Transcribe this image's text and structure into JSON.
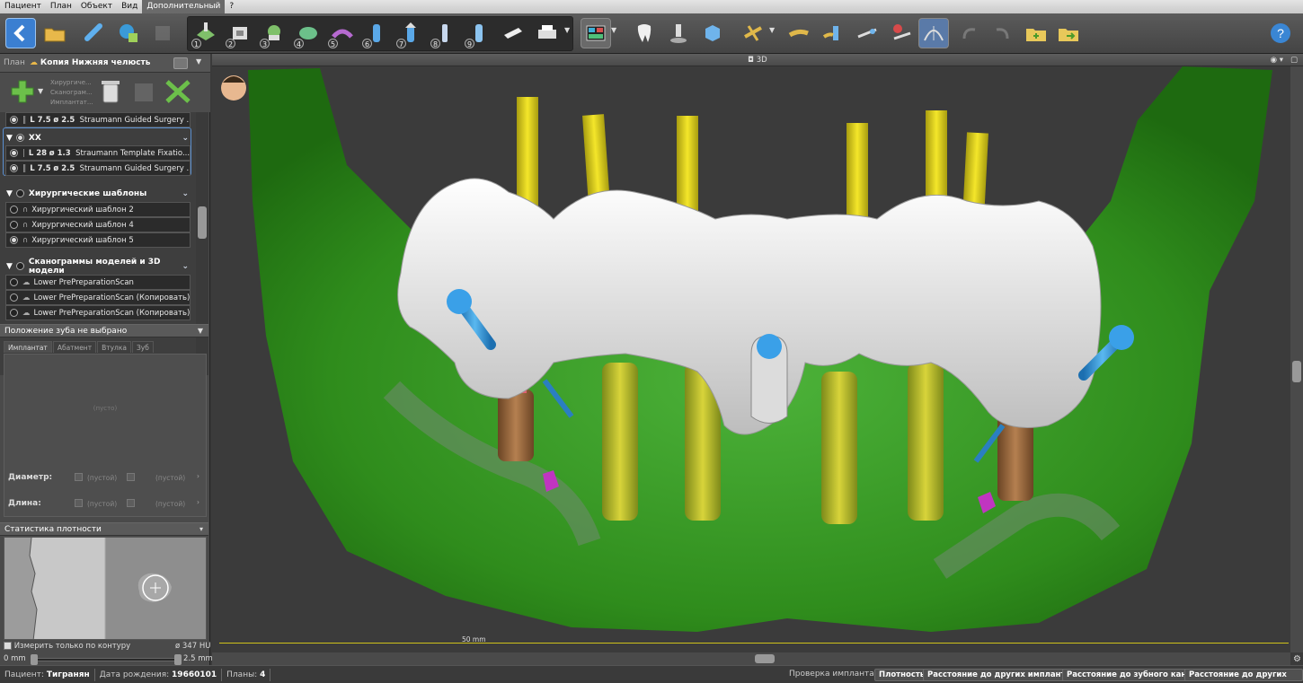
{
  "menu": [
    "Пациент",
    "План",
    "Объект",
    "Вид",
    "Дополнительный",
    "?"
  ],
  "menu_active": "Дополнительный",
  "toolbar": {
    "step_numbers": [
      "1",
      "2",
      "3",
      "4",
      "5",
      "6",
      "7",
      "8",
      "9"
    ]
  },
  "plan_panel": {
    "label": "План",
    "title": "Копия Нижняя челюсть",
    "side_labels": [
      "Хирургиче...",
      "Сканограм...",
      "Имплантат..."
    ]
  },
  "tree": {
    "top_row": {
      "L": "L 7.5",
      "d": "ø 2.5",
      "name": "Straumann Guided Surgery ..."
    },
    "group_xx": "XX",
    "xx_rows": [
      {
        "L": "L 28",
        "d": "ø 1.3",
        "name": "Straumann Template Fixatio..."
      },
      {
        "L": "L 7.5",
        "d": "ø 2.5",
        "name": "Straumann Guided Surgery ..."
      }
    ],
    "group_templates": "Хирургические шаблоны",
    "templates": [
      "Хирургический шаблон 2",
      "Хирургический шаблон 4",
      "Хирургический шаблон 5"
    ],
    "group_scans": "Сканограммы моделей и 3D модели",
    "scans": [
      "Lower PrePreparationScan",
      "Lower PrePreparationScan (Копировать)",
      "Lower PrePreparationScan (Копировать) (К..."
    ]
  },
  "tooth_section": {
    "title": "Положение зуба не выбрано",
    "tabs": [
      "Имплантат",
      "Абатмент",
      "Втулка",
      "Зуб"
    ],
    "empty": "(пусто)",
    "diameter_label": "Диаметр:",
    "length_label": "Длина:",
    "empty_value": "(пустой)"
  },
  "density": {
    "title": "Статистика плотности",
    "contour_label": "Измерить только по контуру",
    "hu": "ø 347 HU",
    "min": "0 mm",
    "max": "2.5 mm"
  },
  "viewport": {
    "title": "3D",
    "scale_label": "50 mm"
  },
  "status": {
    "patient_label": "Пациент:",
    "patient": "Тигранян",
    "dob_label": "Дата рождения:",
    "dob": "19660101",
    "plans_label": "Планы:",
    "plans": "4",
    "check_label": "Проверка имплантата :",
    "buttons": [
      "Плотность",
      "Расстояние до других имплантатов",
      "Расстояние до зубного канала",
      "Расстояние до других втулок"
    ]
  },
  "colors": {
    "bone": "#2f8c1c",
    "guide": "#e6e6e6",
    "drill_sleeve": "#f0e216",
    "pin": "#2f8fd8",
    "implant_yellow": "#c9c22a",
    "implant_brown": "#9a6a3c",
    "accent_pink": "#d03bc0"
  }
}
